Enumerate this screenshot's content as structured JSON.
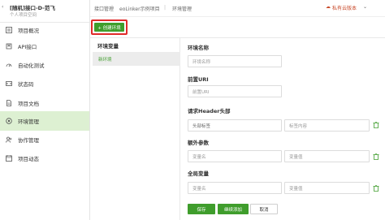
{
  "project": {
    "name": "[随机]接口-D-范飞",
    "subtitle": "个人项目空间"
  },
  "sidebar": {
    "items": [
      {
        "label": "项目概况",
        "icon": "project-overview-icon"
      },
      {
        "label": "API接口",
        "icon": "api-icon"
      },
      {
        "label": "自动化测试",
        "icon": "automation-icon"
      },
      {
        "label": "状态码",
        "icon": "status-code-icon"
      },
      {
        "label": "项目文档",
        "icon": "document-icon"
      },
      {
        "label": "环境管理",
        "icon": "environment-icon",
        "active": true
      },
      {
        "label": "协作管理",
        "icon": "collaboration-icon"
      },
      {
        "label": "项目动态",
        "icon": "activity-icon"
      }
    ]
  },
  "breadcrumb": [
    "接口管理",
    "eoLinker示例项目",
    "环境管理"
  ],
  "topbar": {
    "right_link": "私有云版本"
  },
  "toolbar": {
    "create_label": "+ 创建环境"
  },
  "env_list": {
    "title": "环境变量",
    "items": [
      "新环境"
    ]
  },
  "form": {
    "env_name_label": "环境名称",
    "env_name_placeholder": "环境名称",
    "uri_label": "前置URI",
    "uri_placeholder": "前置URI",
    "header_label": "请求Header头部",
    "header_select_value": "头部标签",
    "header_value_placeholder": "标签内容",
    "extra_params_label": "额外参数",
    "extra_name_placeholder": "变量名",
    "extra_value_placeholder": "变量值",
    "global_vars_label": "全局变量",
    "global_name_placeholder": "变量名",
    "global_value_placeholder": "变量值"
  },
  "actions": {
    "save": "保存",
    "continue_add": "继续添加",
    "cancel": "取消"
  },
  "colors": {
    "accent": "#3f9d2c",
    "active_bg": "#ddf0d2",
    "highlight_border": "#e02a2a",
    "link": "#c94a2a"
  }
}
